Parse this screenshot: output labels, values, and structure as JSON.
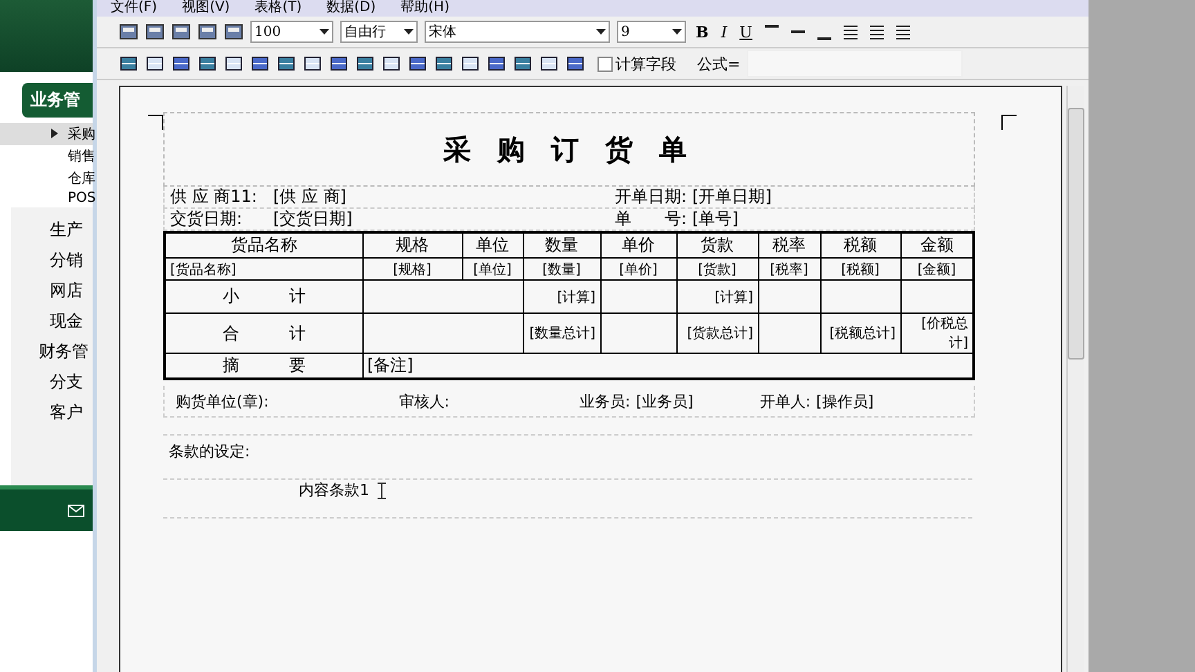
{
  "menu_bar": [
    "文件(F)",
    "视图(V)",
    "表格(T)",
    "数据(D)",
    "帮助(H)"
  ],
  "sidebar": {
    "section": "业务管",
    "items": [
      {
        "label": "采购",
        "selected": true
      },
      {
        "label": "销售",
        "selected": false
      },
      {
        "label": "仓库",
        "selected": false
      },
      {
        "label": "POS",
        "selected": false
      }
    ],
    "modules": [
      "生产",
      "分销",
      "网店",
      "现金",
      "财务管",
      "分支",
      "客户"
    ]
  },
  "toolbar": {
    "zoom": "100",
    "row_mode": "自由行",
    "font": "宋体",
    "size": "9",
    "bold": "B",
    "italic": "I",
    "underline": "U",
    "calc_field": {
      "label": "计算字段",
      "checked": false
    },
    "formula_label": "公式="
  },
  "report": {
    "title": "采 购 订 货 单",
    "header": [
      {
        "label": "供 应 商11:",
        "value": "[供 应 商]",
        "label2": "开单日期:",
        "value2": "[开单日期]"
      },
      {
        "label": "交货日期:",
        "value": "[交货日期]",
        "label2": "单　　号:",
        "value2": "[单号]"
      }
    ],
    "columns": [
      "货品名称",
      "规格",
      "单位",
      "数量",
      "单价",
      "货款",
      "税率",
      "税额",
      "金额"
    ],
    "rows": [
      {
        "kind": "detail",
        "cells": [
          "[货品名称]",
          "[规格]",
          "[单位]",
          "[数量]",
          "[单价]",
          "[货款]",
          "[税率]",
          "[税额]",
          "[金额]"
        ]
      },
      {
        "kind": "summary",
        "cells": [
          "小　　　计",
          "",
          "",
          "[计算]",
          "",
          "[计算]",
          "",
          "",
          ""
        ]
      },
      {
        "kind": "summary",
        "cells": [
          "合　　　计",
          "",
          "",
          "[数量总计]",
          "",
          "[货款总计]",
          "",
          "[税额总计]",
          "[价税总计]"
        ]
      },
      {
        "kind": "remark",
        "cells": [
          "摘　　　要",
          "[备注]",
          "",
          "",
          "",
          "",
          "",
          "",
          ""
        ]
      }
    ],
    "signatures": [
      {
        "label": "购货单位(章):"
      },
      {
        "label": "审核人:"
      },
      {
        "label": "业务员:",
        "value": "[业务员]"
      },
      {
        "label": "开单人:",
        "value": "[操作员]"
      }
    ],
    "terms_label": "条款的设定:",
    "terms_item": "内容条款1"
  }
}
